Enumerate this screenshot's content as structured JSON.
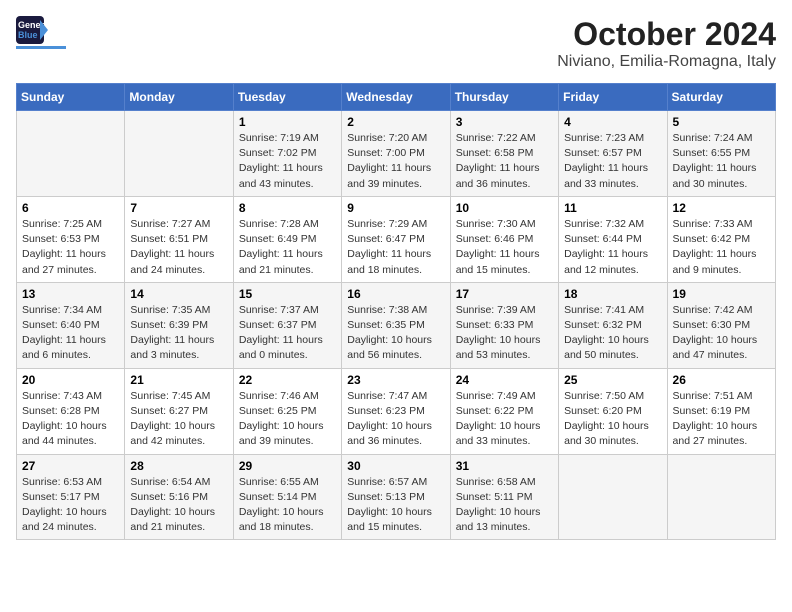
{
  "logo": {
    "part1": "General",
    "part2": "Blue"
  },
  "title": "October 2024",
  "subtitle": "Niviano, Emilia-Romagna, Italy",
  "headers": [
    "Sunday",
    "Monday",
    "Tuesday",
    "Wednesday",
    "Thursday",
    "Friday",
    "Saturday"
  ],
  "weeks": [
    [
      {
        "day": "",
        "detail": ""
      },
      {
        "day": "",
        "detail": ""
      },
      {
        "day": "1",
        "detail": "Sunrise: 7:19 AM\nSunset: 7:02 PM\nDaylight: 11 hours and 43 minutes."
      },
      {
        "day": "2",
        "detail": "Sunrise: 7:20 AM\nSunset: 7:00 PM\nDaylight: 11 hours and 39 minutes."
      },
      {
        "day": "3",
        "detail": "Sunrise: 7:22 AM\nSunset: 6:58 PM\nDaylight: 11 hours and 36 minutes."
      },
      {
        "day": "4",
        "detail": "Sunrise: 7:23 AM\nSunset: 6:57 PM\nDaylight: 11 hours and 33 minutes."
      },
      {
        "day": "5",
        "detail": "Sunrise: 7:24 AM\nSunset: 6:55 PM\nDaylight: 11 hours and 30 minutes."
      }
    ],
    [
      {
        "day": "6",
        "detail": "Sunrise: 7:25 AM\nSunset: 6:53 PM\nDaylight: 11 hours and 27 minutes."
      },
      {
        "day": "7",
        "detail": "Sunrise: 7:27 AM\nSunset: 6:51 PM\nDaylight: 11 hours and 24 minutes."
      },
      {
        "day": "8",
        "detail": "Sunrise: 7:28 AM\nSunset: 6:49 PM\nDaylight: 11 hours and 21 minutes."
      },
      {
        "day": "9",
        "detail": "Sunrise: 7:29 AM\nSunset: 6:47 PM\nDaylight: 11 hours and 18 minutes."
      },
      {
        "day": "10",
        "detail": "Sunrise: 7:30 AM\nSunset: 6:46 PM\nDaylight: 11 hours and 15 minutes."
      },
      {
        "day": "11",
        "detail": "Sunrise: 7:32 AM\nSunset: 6:44 PM\nDaylight: 11 hours and 12 minutes."
      },
      {
        "day": "12",
        "detail": "Sunrise: 7:33 AM\nSunset: 6:42 PM\nDaylight: 11 hours and 9 minutes."
      }
    ],
    [
      {
        "day": "13",
        "detail": "Sunrise: 7:34 AM\nSunset: 6:40 PM\nDaylight: 11 hours and 6 minutes."
      },
      {
        "day": "14",
        "detail": "Sunrise: 7:35 AM\nSunset: 6:39 PM\nDaylight: 11 hours and 3 minutes."
      },
      {
        "day": "15",
        "detail": "Sunrise: 7:37 AM\nSunset: 6:37 PM\nDaylight: 11 hours and 0 minutes."
      },
      {
        "day": "16",
        "detail": "Sunrise: 7:38 AM\nSunset: 6:35 PM\nDaylight: 10 hours and 56 minutes."
      },
      {
        "day": "17",
        "detail": "Sunrise: 7:39 AM\nSunset: 6:33 PM\nDaylight: 10 hours and 53 minutes."
      },
      {
        "day": "18",
        "detail": "Sunrise: 7:41 AM\nSunset: 6:32 PM\nDaylight: 10 hours and 50 minutes."
      },
      {
        "day": "19",
        "detail": "Sunrise: 7:42 AM\nSunset: 6:30 PM\nDaylight: 10 hours and 47 minutes."
      }
    ],
    [
      {
        "day": "20",
        "detail": "Sunrise: 7:43 AM\nSunset: 6:28 PM\nDaylight: 10 hours and 44 minutes."
      },
      {
        "day": "21",
        "detail": "Sunrise: 7:45 AM\nSunset: 6:27 PM\nDaylight: 10 hours and 42 minutes."
      },
      {
        "day": "22",
        "detail": "Sunrise: 7:46 AM\nSunset: 6:25 PM\nDaylight: 10 hours and 39 minutes."
      },
      {
        "day": "23",
        "detail": "Sunrise: 7:47 AM\nSunset: 6:23 PM\nDaylight: 10 hours and 36 minutes."
      },
      {
        "day": "24",
        "detail": "Sunrise: 7:49 AM\nSunset: 6:22 PM\nDaylight: 10 hours and 33 minutes."
      },
      {
        "day": "25",
        "detail": "Sunrise: 7:50 AM\nSunset: 6:20 PM\nDaylight: 10 hours and 30 minutes."
      },
      {
        "day": "26",
        "detail": "Sunrise: 7:51 AM\nSunset: 6:19 PM\nDaylight: 10 hours and 27 minutes."
      }
    ],
    [
      {
        "day": "27",
        "detail": "Sunrise: 6:53 AM\nSunset: 5:17 PM\nDaylight: 10 hours and 24 minutes."
      },
      {
        "day": "28",
        "detail": "Sunrise: 6:54 AM\nSunset: 5:16 PM\nDaylight: 10 hours and 21 minutes."
      },
      {
        "day": "29",
        "detail": "Sunrise: 6:55 AM\nSunset: 5:14 PM\nDaylight: 10 hours and 18 minutes."
      },
      {
        "day": "30",
        "detail": "Sunrise: 6:57 AM\nSunset: 5:13 PM\nDaylight: 10 hours and 15 minutes."
      },
      {
        "day": "31",
        "detail": "Sunrise: 6:58 AM\nSunset: 5:11 PM\nDaylight: 10 hours and 13 minutes."
      },
      {
        "day": "",
        "detail": ""
      },
      {
        "day": "",
        "detail": ""
      }
    ]
  ]
}
